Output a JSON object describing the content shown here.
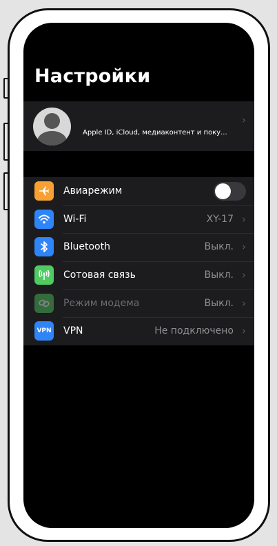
{
  "header": {
    "title": "Настройки"
  },
  "profile": {
    "subtitle": "Apple ID, iCloud, медиаконтент и поку..."
  },
  "settings": [
    {
      "label": "Авиарежим",
      "icon": "airplane-icon",
      "color": "#f7a034",
      "toggle": false
    },
    {
      "label": "Wi-Fi",
      "value": "XY-17",
      "icon": "wifi-icon",
      "color": "#2f84f7"
    },
    {
      "label": "Bluetooth",
      "value": "Выкл.",
      "icon": "bluetooth-icon",
      "color": "#2f84f7"
    },
    {
      "label": "Сотовая связь",
      "value": "Выкл.",
      "icon": "antenna-icon",
      "color": "#4fcb62"
    },
    {
      "label": "Режим модема",
      "value": "Выкл.",
      "icon": "hotspot-icon",
      "color": "#4fcb62",
      "dimmed": true
    },
    {
      "label": "VPN",
      "value": "Не подключено",
      "icon": "vpn-icon",
      "color": "#2f84f7",
      "icon_text": "VPN"
    }
  ]
}
